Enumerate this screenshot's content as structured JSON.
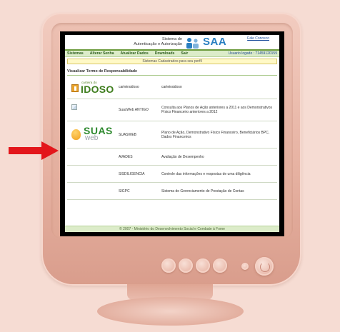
{
  "header": {
    "system_title_line1": "Sistema de",
    "system_title_line2": "Autenticação e Autorização",
    "app_name": "SAA",
    "contact_link": "Fale Conosco"
  },
  "menu": {
    "items": [
      "Sistemas",
      "Alterar Senha",
      "Atualizar Dados",
      "Downloads",
      "Sair"
    ],
    "user_label": "Usuario logado : 71459120159"
  },
  "notice": "Sistemas Cadastrados para seu perfil",
  "section_title": "Visualizar Termo de Responsabilidade",
  "systems": [
    {
      "logo_small_text": "carteira do",
      "logo_text": "IDOSO",
      "name": "carteiraidoso",
      "description": "carteiraidoso"
    },
    {
      "logo_text": "",
      "name": "SuasWeb ANTIGO",
      "description": "Consulta aos Planos de Ação anteriores a 2011 e aos Demonstrativos Físico Financeiro anteriores a 2012"
    },
    {
      "logo_text": "SUAS",
      "logo_sub_text": "web",
      "name": "SUASWEB",
      "description": "Plano de Ação, Demonstrativo Físico Financeiro, Beneficiários BPC, Dados Financeiros"
    },
    {
      "logo_text": "",
      "name": "AVADES",
      "description": "Avaliação de Desempenho"
    },
    {
      "logo_text": "",
      "name": "SISDILIGENCIA",
      "description": "Controle das informações e respostas de uma diligência"
    },
    {
      "logo_text": "",
      "name": "SIGPC",
      "description": "Sistema de Gerenciamento de Prestação de Contas"
    }
  ],
  "footer": "© 2007 - Ministério do Desenvolvimento Social e Combate à Fome",
  "colors": {
    "background": "#f6dcd3",
    "monitor": "#e7b3a3",
    "arrow": "#e3161b",
    "menu_bg": "#dcecc9",
    "notice_bg": "#fff9c6",
    "saa_blue": "#2a7fc0"
  }
}
